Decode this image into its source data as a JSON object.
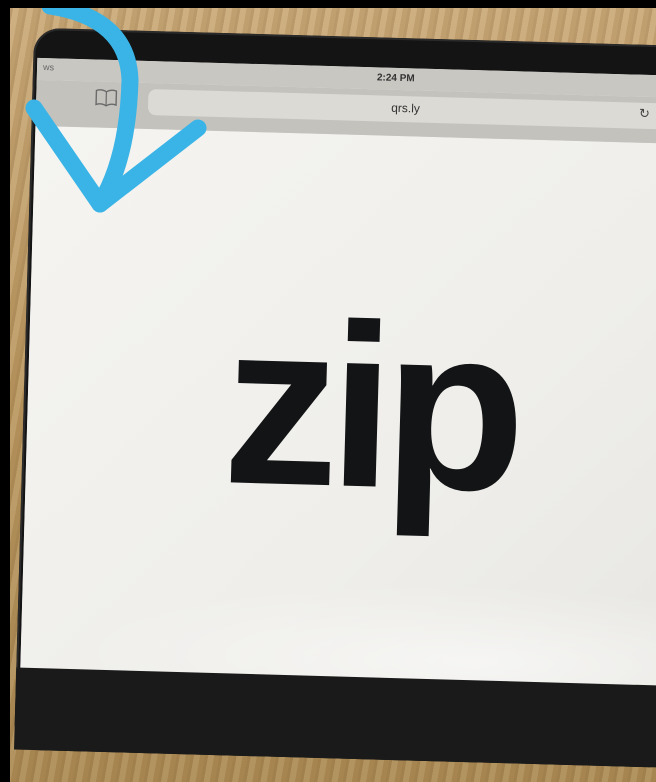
{
  "status_bar": {
    "carrier": "ws",
    "time": "2:24 PM"
  },
  "browser": {
    "address": "qrs.ly",
    "reload_icon": "reload-icon",
    "bookmarks_icon": "bookmarks-icon"
  },
  "page": {
    "logo_text": "zip"
  },
  "annotation": {
    "arrow_color": "#3ab4e6"
  }
}
